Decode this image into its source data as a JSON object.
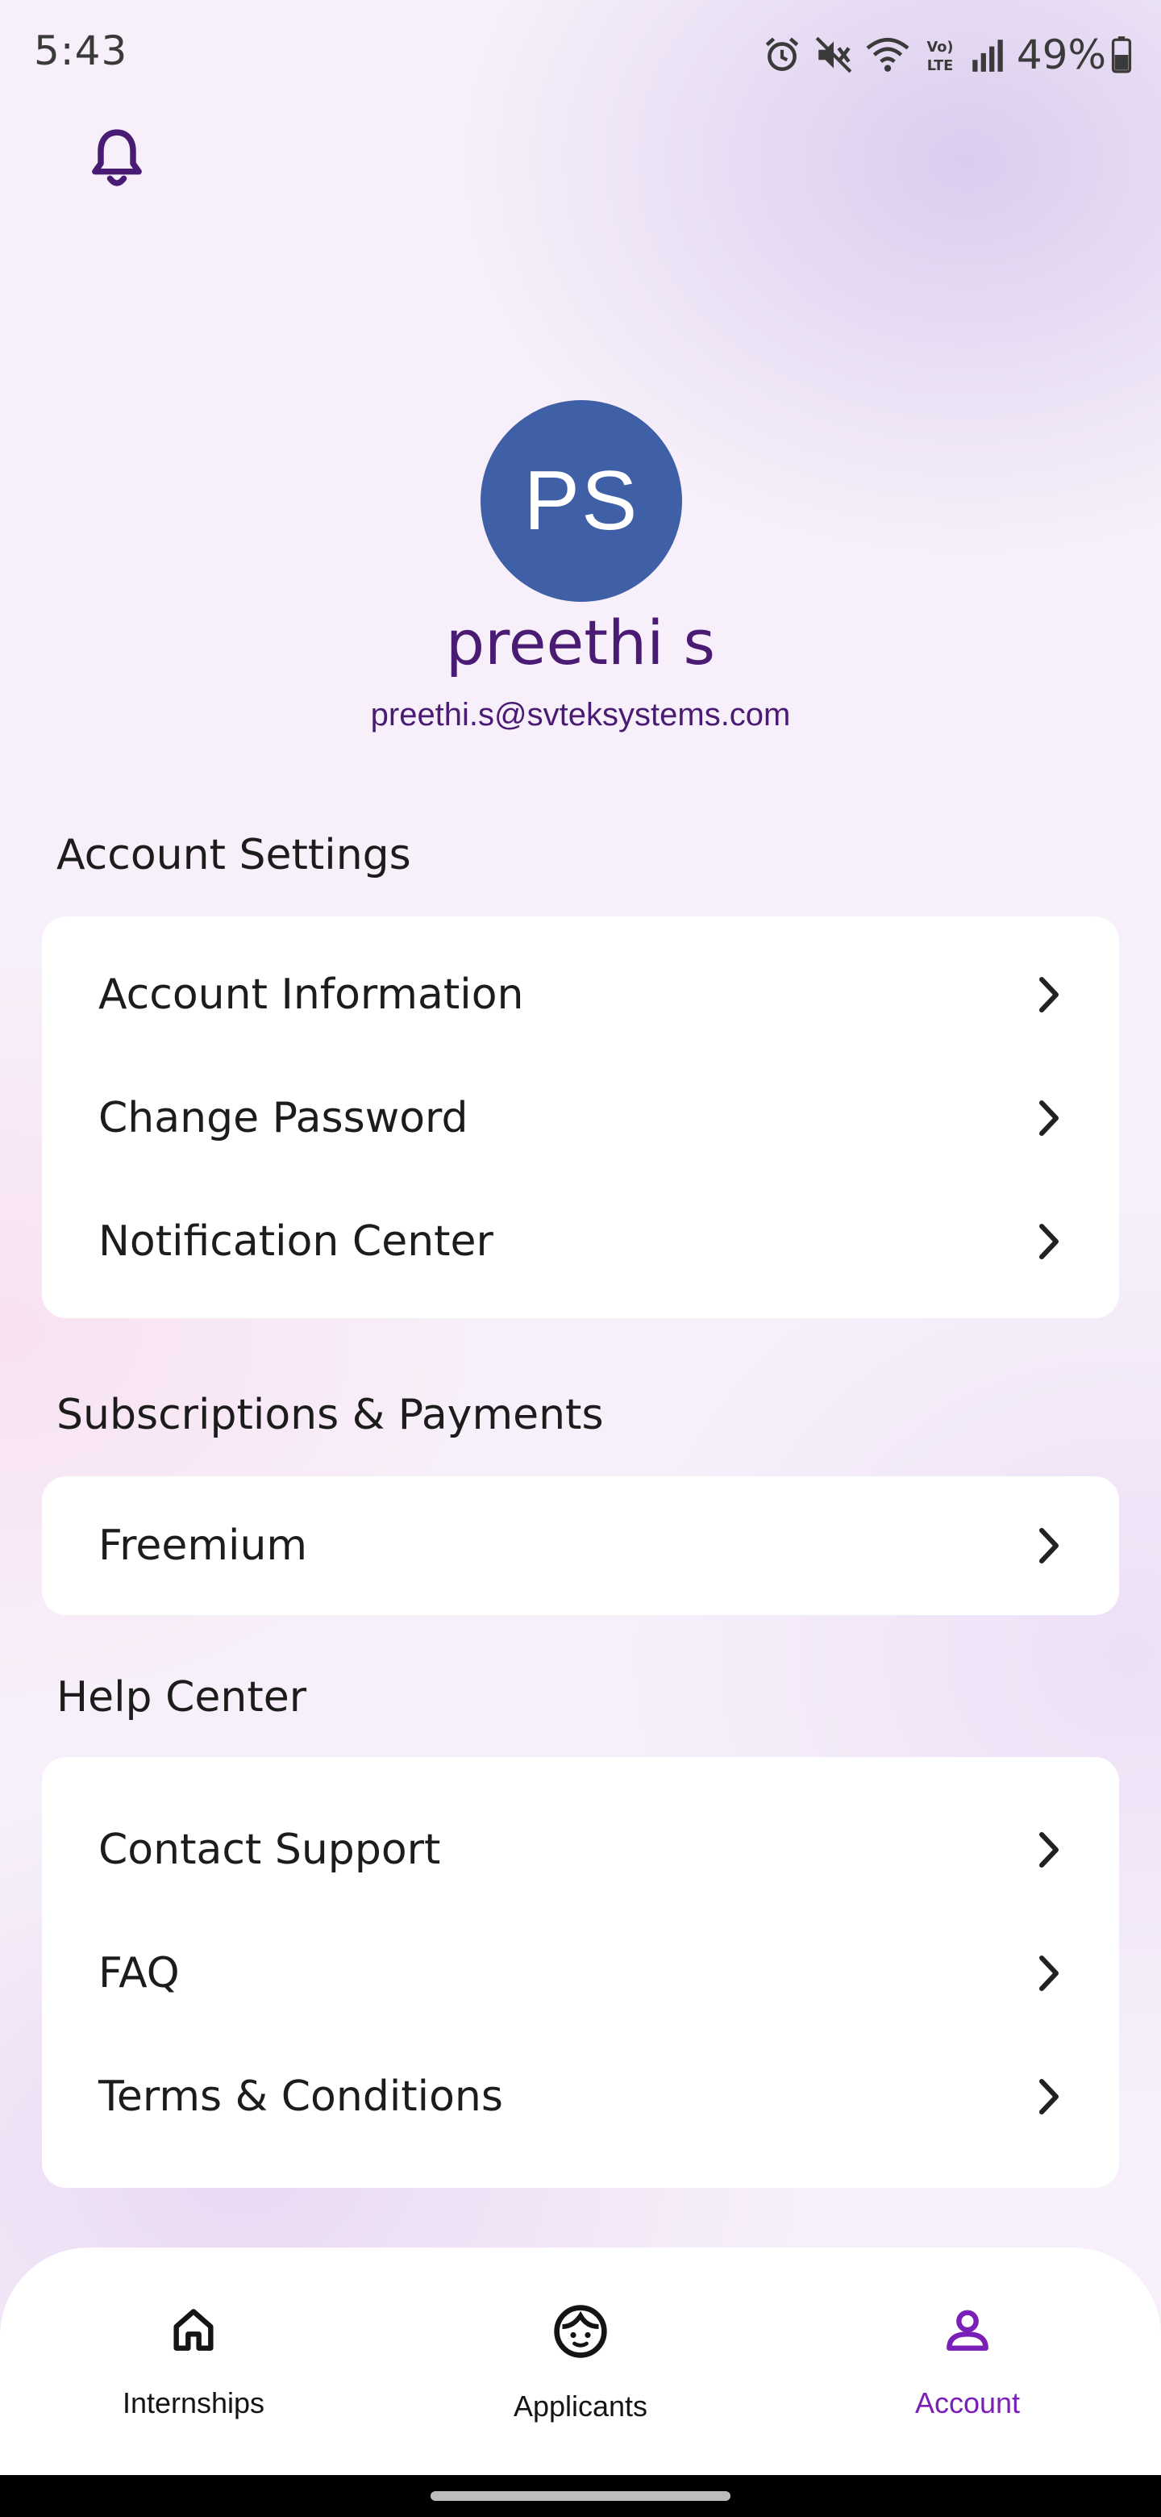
{
  "status_bar": {
    "time": "5:43",
    "battery": "49%",
    "icons": [
      "alarm-icon",
      "mute-icon",
      "wifi-icon",
      "volte-icon",
      "signal-icon",
      "battery-icon"
    ],
    "volte_text": "Vo) LTE"
  },
  "header": {
    "icon": "bell-icon",
    "accent": "#4a1b73"
  },
  "profile": {
    "initials": "PS",
    "name": "preethi s",
    "email": "preethi.s@svteksystems.com",
    "avatar_color": "#3f5fa7"
  },
  "sections": {
    "account_settings": {
      "title": "Account Settings",
      "items": [
        {
          "label": "Account Information"
        },
        {
          "label": "Change Password"
        },
        {
          "label": "Notification Center"
        }
      ]
    },
    "subscriptions": {
      "title": "Subscriptions & Payments",
      "items": [
        {
          "label": "Freemium"
        }
      ]
    },
    "help_center": {
      "title": "Help Center",
      "items": [
        {
          "label": "Contact Support"
        },
        {
          "label": "FAQ"
        },
        {
          "label": "Terms & Conditions"
        }
      ]
    }
  },
  "bottom_nav": {
    "items": [
      {
        "label": "Internships",
        "icon": "home-icon",
        "active": false
      },
      {
        "label": "Applicants",
        "icon": "face-icon",
        "active": false
      },
      {
        "label": "Account",
        "icon": "person-icon",
        "active": true
      }
    ],
    "active_color": "#7a1fb8",
    "inactive_color": "#141414"
  }
}
